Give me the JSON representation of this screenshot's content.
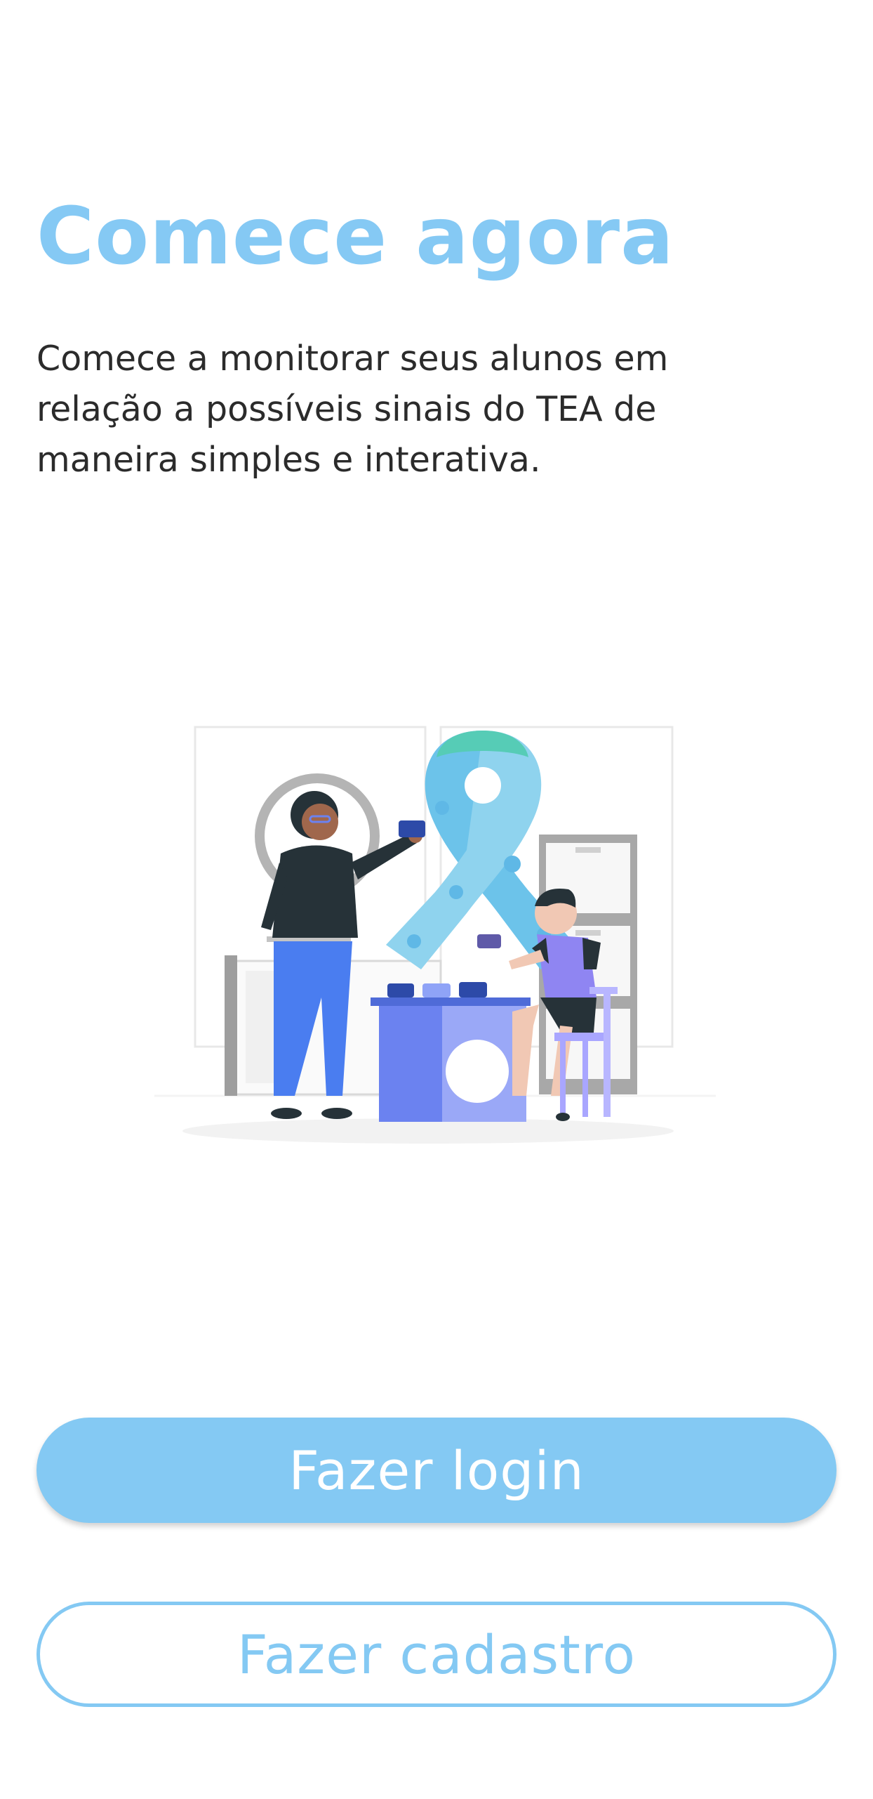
{
  "header": {
    "title": "Comece agora",
    "description": "Comece a monitorar seus alunos em relação a possíveis sinais do TEA de maneira simples e interativa."
  },
  "illustration": {
    "icon": "autism-awareness-ribbon-illustration"
  },
  "actions": {
    "login_label": "Fazer login",
    "signup_label": "Fazer cadastro"
  },
  "colors": {
    "accent": "#84c9f3",
    "text": "#2b2b2b",
    "background": "#ffffff"
  }
}
